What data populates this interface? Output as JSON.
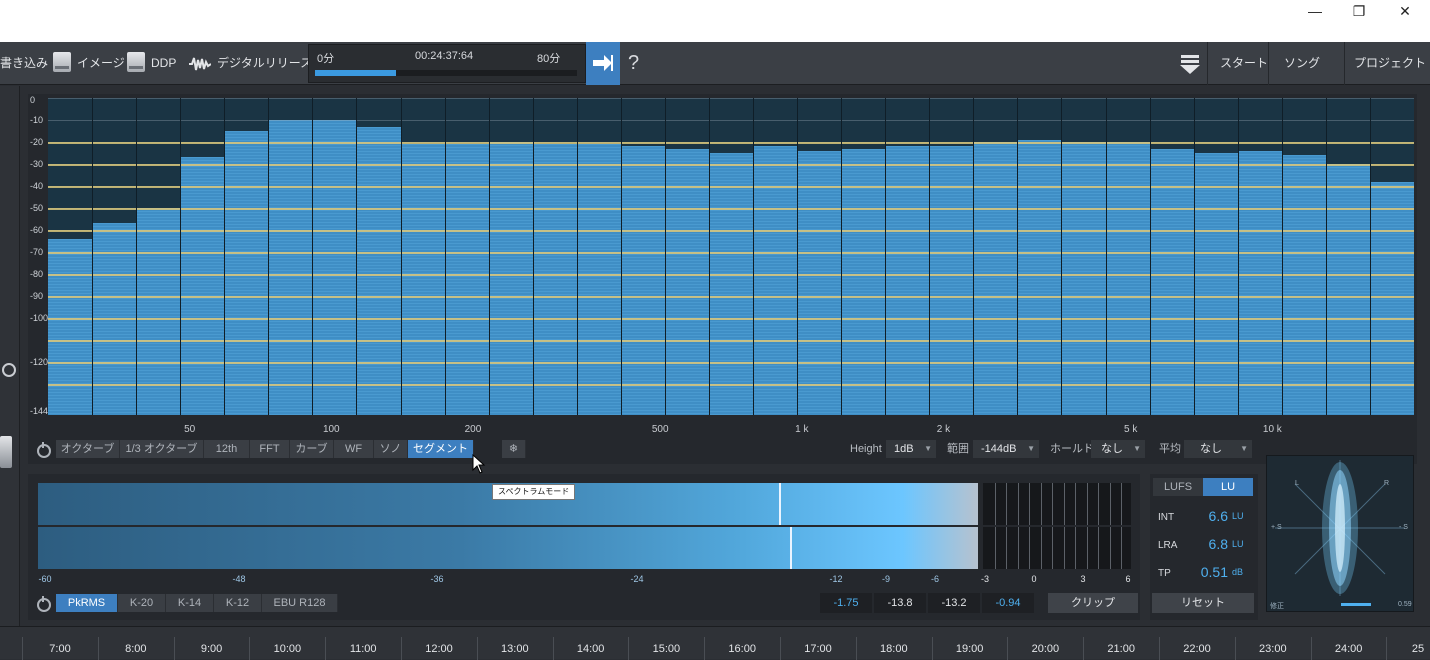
{
  "window": {
    "minimize": "—",
    "maximize": "❐",
    "close": "✕"
  },
  "toolbar": {
    "burn": "書き込み",
    "image": "イメージ",
    "ddp": "DDP",
    "digital_release": "デジタルリリース",
    "start": "スタート",
    "song": "ソング",
    "project": "プロジェクト"
  },
  "transport": {
    "start_label": "0分",
    "time": "00:24:37:64",
    "end_label": "80分",
    "progress": 0.31
  },
  "help_label": "?",
  "spectrum": {
    "y_labels": [
      "0",
      "-10",
      "-20",
      "-30",
      "-40",
      "-50",
      "-60",
      "-70",
      "-80",
      "-90",
      "-100",
      "-120",
      "-144"
    ],
    "x_labels": [
      "50",
      "100",
      "200",
      "500",
      "1 k",
      "2 k",
      "5 k",
      "10 k"
    ],
    "bars_db": [
      -64,
      -57,
      -50,
      -27,
      -15,
      -10,
      -10,
      -13,
      -21,
      -21,
      -20,
      -21,
      -21,
      -22,
      -23,
      -25,
      -22,
      -24,
      -23,
      -22,
      -22,
      -20,
      -19,
      -20,
      -20,
      -23,
      -25,
      -24,
      -26,
      -30,
      -38
    ]
  },
  "modes": [
    "オクターブ",
    "1/3 オクターブ",
    "12th",
    "FFT",
    "カーブ",
    "WF",
    "ソノ",
    "セグメント"
  ],
  "active_mode": "セグメント",
  "controls": {
    "height_label": "Height",
    "height_value": "1dB",
    "range_label": "範囲",
    "range_value": "-144dB",
    "hold_label": "ホールド",
    "hold_value": "なし",
    "avg_label": "平均",
    "avg_value": "なし"
  },
  "tooltip": "スペクトラムモード",
  "meter": {
    "scale": [
      "-60",
      "-48",
      "-36",
      "-24",
      "-12",
      "-9",
      "-6",
      "-3",
      "0",
      "3",
      "6"
    ],
    "modes": [
      "PkRMS",
      "K-20",
      "K-14",
      "K-12",
      "EBU R128"
    ],
    "active_mode": "PkRMS",
    "readouts": [
      "-1.75",
      "-13.8",
      "-13.2",
      "-0.94"
    ],
    "clip_label": "クリップ"
  },
  "loudness": {
    "tab_lufs": "LUFS",
    "tab_lu": "LU",
    "int_label": "INT",
    "int_value": "6.6",
    "int_unit": "LU",
    "lra_label": "LRA",
    "lra_value": "6.8",
    "lra_unit": "LU",
    "tp_label": "TP",
    "tp_value": "0.51",
    "tp_unit": "dB",
    "reset_label": "リセット"
  },
  "scope": {
    "l": "L",
    "r": "R",
    "plus_s": "+ S",
    "minus_s": "- S",
    "correction_label": "修正",
    "correction_value": "0.59"
  },
  "timeline": [
    "7:00",
    "8:00",
    "9:00",
    "10:00",
    "11:00",
    "12:00",
    "13:00",
    "14:00",
    "15:00",
    "16:00",
    "17:00",
    "18:00",
    "19:00",
    "20:00",
    "21:00",
    "22:00",
    "23:00",
    "24:00",
    "25"
  ]
}
